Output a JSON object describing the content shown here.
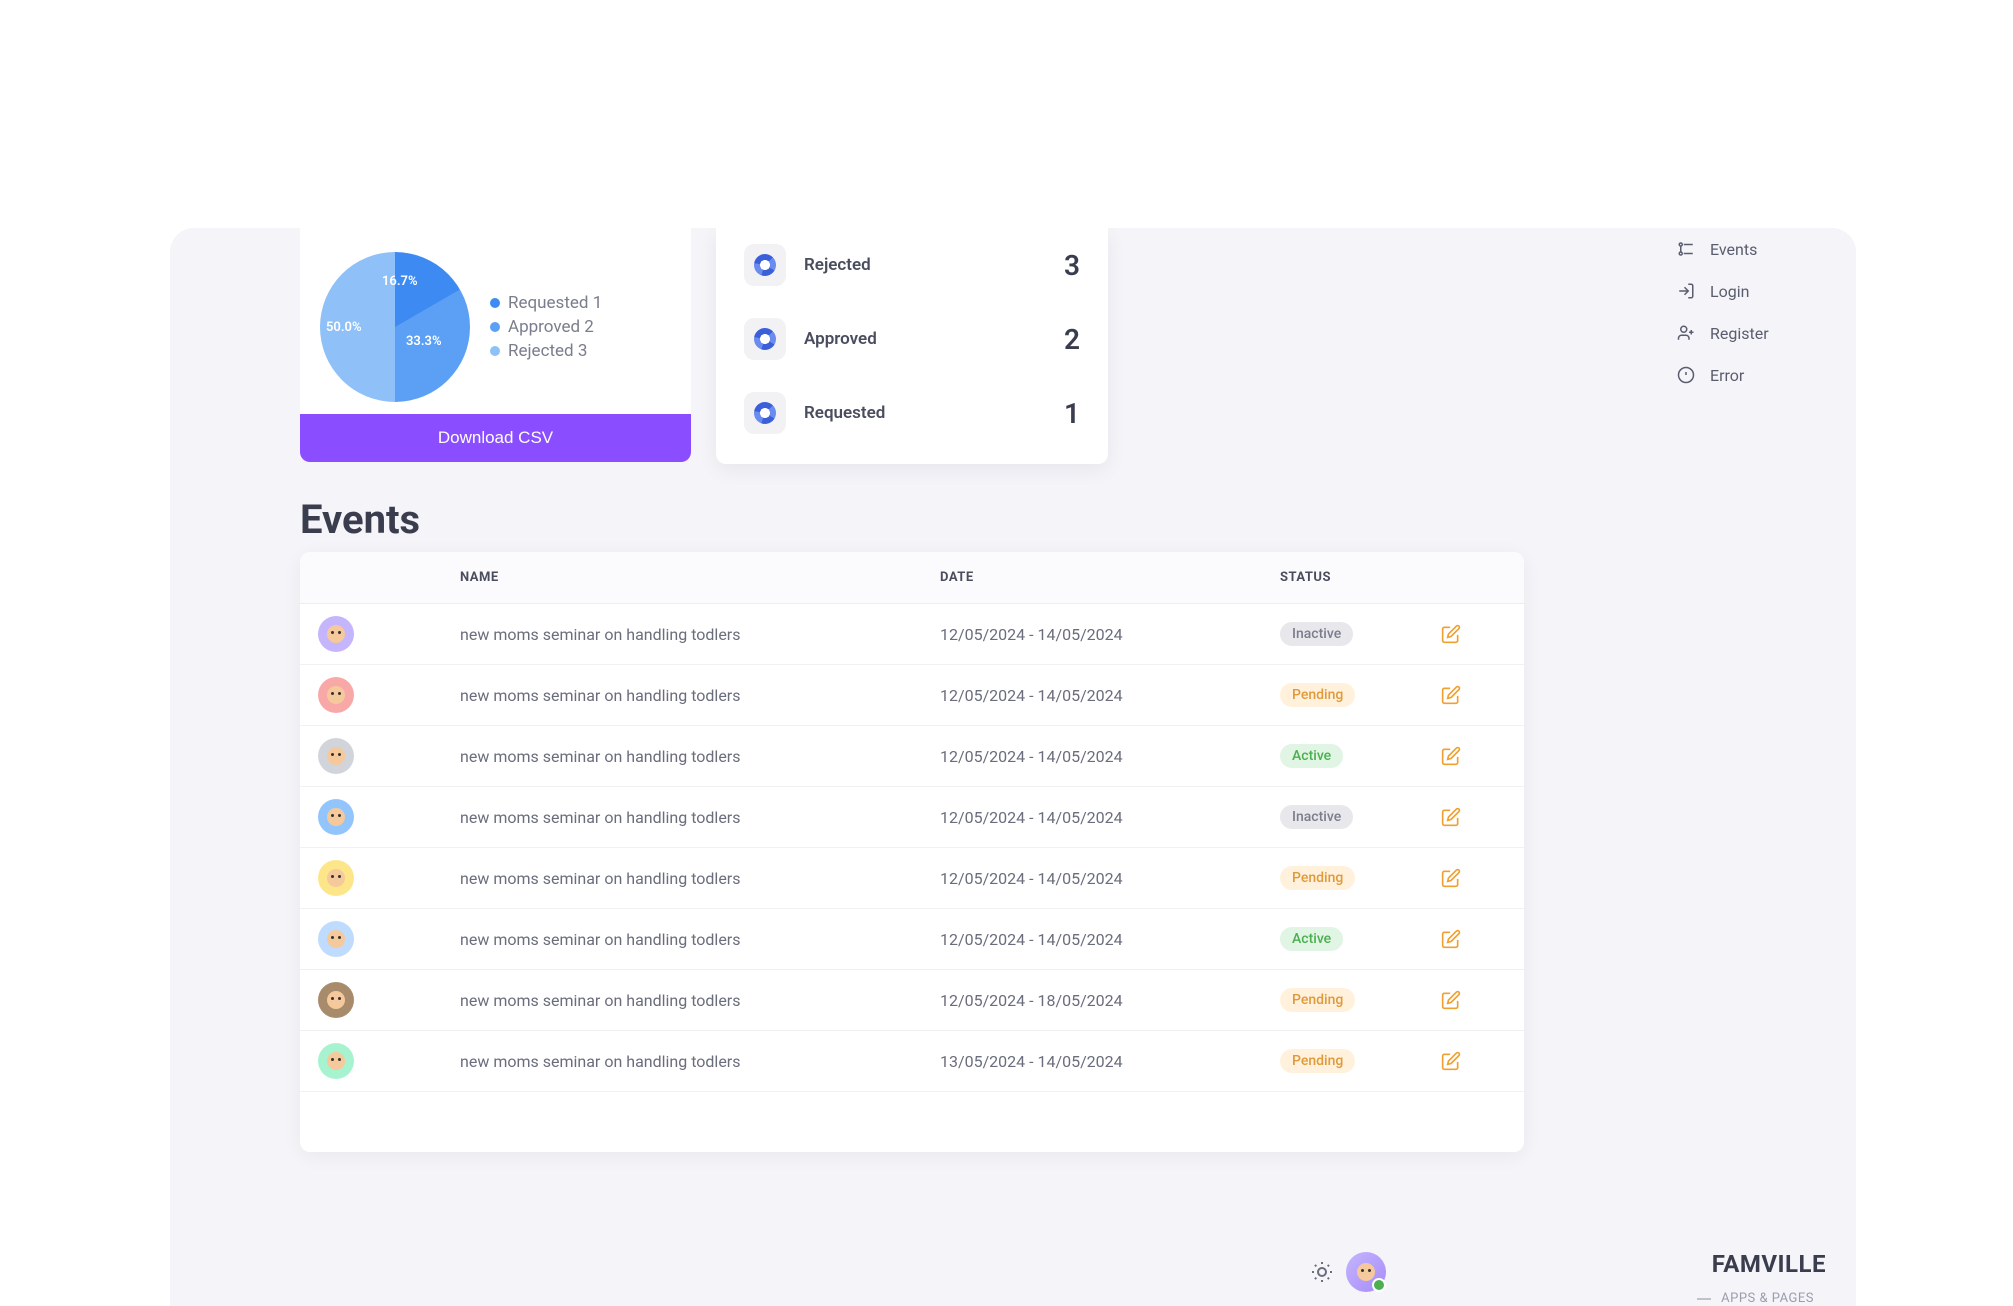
{
  "chart_data": {
    "type": "pie",
    "categories": [
      "Requested",
      "Approved",
      "Rejected"
    ],
    "values": [
      1,
      2,
      3
    ],
    "percentages": [
      "16.7%",
      "33.3%",
      "50.0%"
    ],
    "colors": [
      "#3d8bf2",
      "#5ba0f5",
      "#8fc0f8"
    ]
  },
  "summary": {
    "download_label": "Download CSV",
    "legend": [
      {
        "label": "Requested 1",
        "color": "#3d8bf2"
      },
      {
        "label": "Approved 2",
        "color": "#5ba0f5"
      },
      {
        "label": "Rejected 3",
        "color": "#8fc0f8"
      }
    ]
  },
  "stats": [
    {
      "label": "Rejected",
      "value": "3"
    },
    {
      "label": "Approved",
      "value": "2"
    },
    {
      "label": "Requested",
      "value": "1"
    }
  ],
  "events": {
    "heading": "Events",
    "columns": {
      "name": "NAME",
      "date": "DATE",
      "status": "STATUS"
    },
    "rows": [
      {
        "avatar_bg": "#c4b5fd",
        "name": "new moms seminar on handling todlers",
        "date": "12/05/2024 - 14/05/2024",
        "status": "Inactive",
        "status_class": "inactive"
      },
      {
        "avatar_bg": "#f9a8a8",
        "name": "new moms seminar on handling todlers",
        "date": "12/05/2024 - 14/05/2024",
        "status": "Pending",
        "status_class": "pending"
      },
      {
        "avatar_bg": "#d1d5db",
        "name": "new moms seminar on handling todlers",
        "date": "12/05/2024 - 14/05/2024",
        "status": "Active",
        "status_class": "active"
      },
      {
        "avatar_bg": "#93c5fd",
        "name": "new moms seminar on handling todlers",
        "date": "12/05/2024 - 14/05/2024",
        "status": "Inactive",
        "status_class": "inactive"
      },
      {
        "avatar_bg": "#fde68a",
        "name": "new moms seminar on handling todlers",
        "date": "12/05/2024 - 14/05/2024",
        "status": "Pending",
        "status_class": "pending"
      },
      {
        "avatar_bg": "#bfdbfe",
        "name": "new moms seminar on handling todlers",
        "date": "12/05/2024 - 14/05/2024",
        "status": "Active",
        "status_class": "active"
      },
      {
        "avatar_bg": "#a78b6a",
        "name": "new moms seminar on handling todlers",
        "date": "12/05/2024 - 18/05/2024",
        "status": "Pending",
        "status_class": "pending"
      },
      {
        "avatar_bg": "#a7f3d0",
        "name": "new moms seminar on handling todlers",
        "date": "13/05/2024 - 14/05/2024",
        "status": "Pending",
        "status_class": "pending"
      }
    ]
  },
  "nav": {
    "items": [
      {
        "label": "Events",
        "icon": "dots"
      },
      {
        "label": "Login",
        "icon": "login"
      },
      {
        "label": "Register",
        "icon": "register"
      },
      {
        "label": "Error",
        "icon": "error"
      }
    ]
  },
  "brand": "FAMVILLE",
  "apps_pages": "APPS & PAGES"
}
